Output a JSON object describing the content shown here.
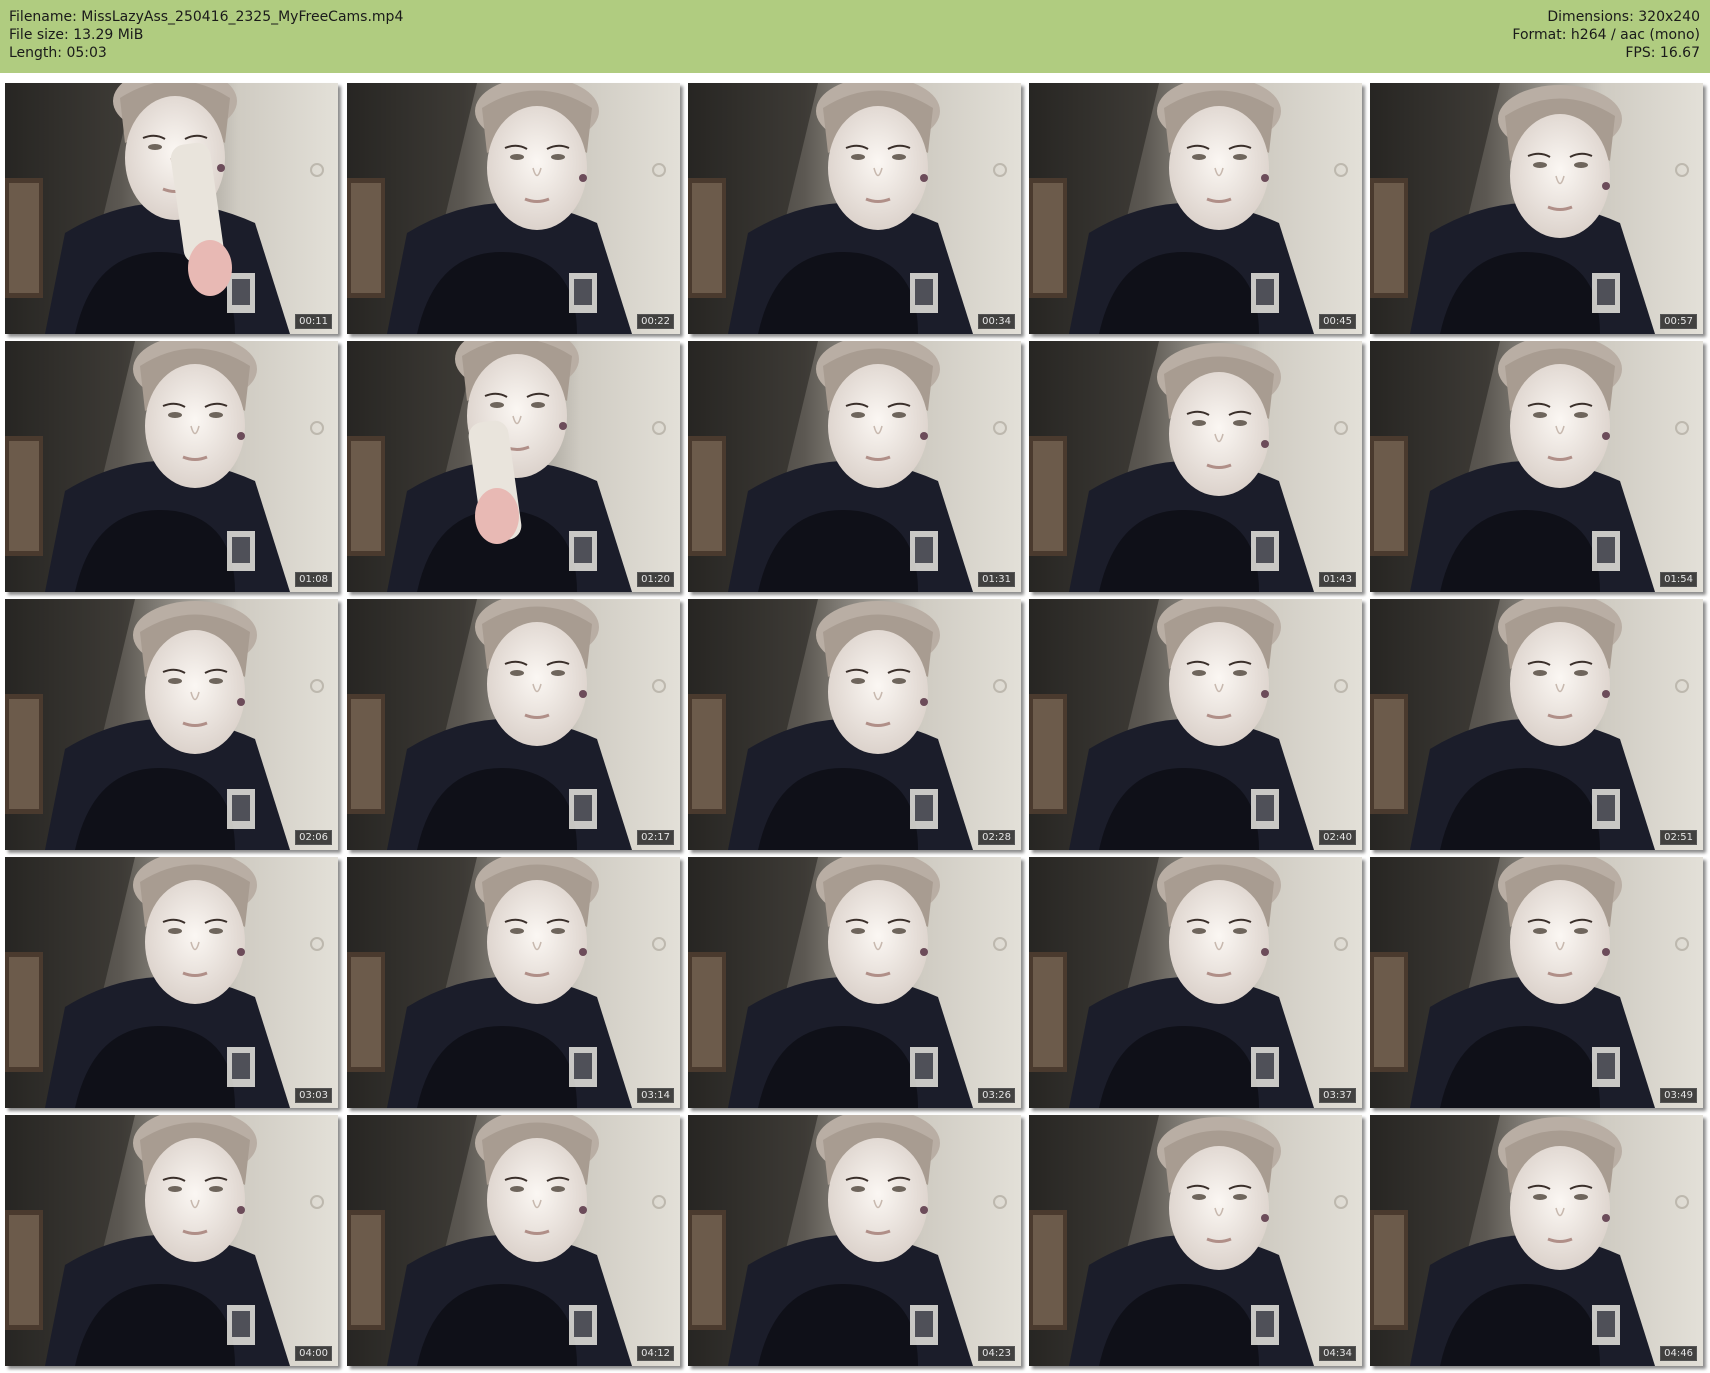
{
  "header": {
    "filename": "Filename: MissLazyAss_250416_2325_MyFreeCams.mp4",
    "filesize": "File size: 13.29 MiB",
    "length": "Length: 05:03",
    "dimensions": "Dimensions: 320x240",
    "format": "Format: h264 / aac (mono)",
    "fps": "FPS: 16.67"
  },
  "colors": {
    "header_bg": "#b0cc80",
    "page_bg": "#ffffff"
  },
  "thumbnails": [
    {
      "time": "00:11",
      "variant": "item"
    },
    {
      "time": "00:22",
      "variant": "normal"
    },
    {
      "time": "00:34",
      "variant": "normal"
    },
    {
      "time": "00:45",
      "variant": "normal"
    },
    {
      "time": "00:57",
      "variant": "down"
    },
    {
      "time": "01:08",
      "variant": "normal"
    },
    {
      "time": "01:20",
      "variant": "item"
    },
    {
      "time": "01:31",
      "variant": "normal"
    },
    {
      "time": "01:43",
      "variant": "down"
    },
    {
      "time": "01:54",
      "variant": "normal"
    },
    {
      "time": "02:06",
      "variant": "down"
    },
    {
      "time": "02:17",
      "variant": "normal"
    },
    {
      "time": "02:28",
      "variant": "down"
    },
    {
      "time": "02:40",
      "variant": "normal"
    },
    {
      "time": "02:51",
      "variant": "normal"
    },
    {
      "time": "03:03",
      "variant": "normal"
    },
    {
      "time": "03:14",
      "variant": "normal"
    },
    {
      "time": "03:26",
      "variant": "normal"
    },
    {
      "time": "03:37",
      "variant": "normal"
    },
    {
      "time": "03:49",
      "variant": "normal"
    },
    {
      "time": "04:00",
      "variant": "normal"
    },
    {
      "time": "04:12",
      "variant": "normal"
    },
    {
      "time": "04:23",
      "variant": "normal"
    },
    {
      "time": "04:34",
      "variant": "down"
    },
    {
      "time": "04:46",
      "variant": "down"
    }
  ]
}
